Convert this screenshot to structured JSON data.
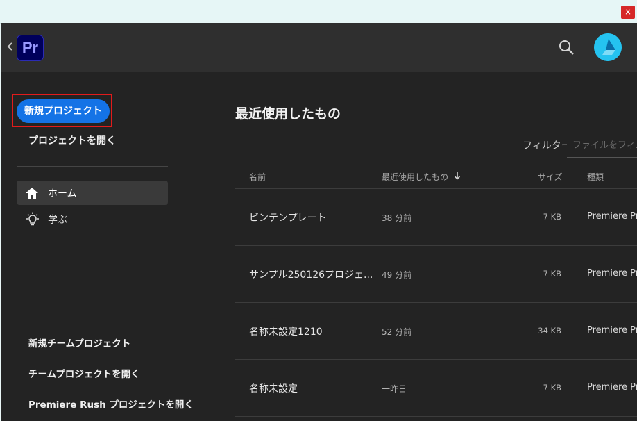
{
  "window": {
    "close_label": "×"
  },
  "header": {
    "app_logo_text": "Pr",
    "accent": "#1473e6",
    "logo_bg": "#00005b",
    "logo_fg": "#9999ff"
  },
  "sidebar": {
    "new_project_label": "新規プロジェクト",
    "open_project_label": "プロジェクトを開く",
    "nav": [
      {
        "label": "ホーム",
        "icon": "home-icon",
        "selected": true
      },
      {
        "label": "学ぶ",
        "icon": "lightbulb-icon",
        "selected": false
      }
    ],
    "bottom_links": [
      "新規チームプロジェクト",
      "チームプロジェクトを開く",
      "Premiere Rush プロジェクトを開く"
    ]
  },
  "main": {
    "title": "最近使用したもの",
    "filter_label": "フィルター",
    "filter_placeholder": "ファイルをフィル",
    "columns": {
      "name": "名前",
      "recent": "最近使用したもの",
      "size": "サイズ",
      "type": "種類"
    },
    "rows": [
      {
        "name": "ビンテンプレート",
        "recent": "38 分前",
        "size": "7 KB",
        "type": "Premiere Pro"
      },
      {
        "name": "サンプル250126プロジェ...",
        "recent": "49 分前",
        "size": "7 KB",
        "type": "Premiere Pro"
      },
      {
        "name": "名称未設定1210",
        "recent": "52 分前",
        "size": "34 KB",
        "type": "Premiere Pro"
      },
      {
        "name": "名称未設定",
        "recent": "一昨日",
        "size": "7 KB",
        "type": "Premiere Pro"
      }
    ]
  }
}
